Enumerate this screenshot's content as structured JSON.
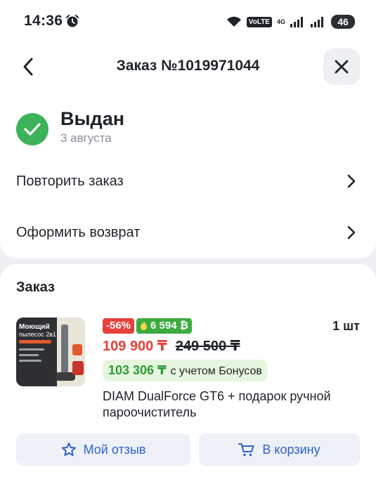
{
  "status_bar": {
    "time": "14:36",
    "volte": "VoLTE",
    "network": "4G",
    "battery": "46",
    "icons": [
      "alarm-icon",
      "wifi-icon",
      "signal-icon",
      "signal-icon",
      "battery-icon"
    ]
  },
  "header": {
    "title": "Заказ №1019971044",
    "back_icon": "chevron-left-icon",
    "close_icon": "close-icon"
  },
  "order_status": {
    "title": "Выдан",
    "date": "3 августа",
    "icon": "check-circle-icon",
    "color": "#3cb35a"
  },
  "actions": [
    {
      "label": "Повторить заказ"
    },
    {
      "label": "Оформить возврат"
    }
  ],
  "order": {
    "section_title": "Заказ",
    "item": {
      "thumbnail_text_1": "Моющий",
      "thumbnail_text_2": "пылесос 2в1",
      "discount": "-56%",
      "bonus": "6 594 ₿",
      "quantity": "1 шт",
      "price": "109 900 ₸",
      "old_price": "249 500 ₸",
      "bonus_price_value": "103 306 ₸",
      "bonus_price_note": "с учетом Бонусов",
      "name": "DIAM DualForce GT6 + подарок ручной пароочиститель"
    },
    "buttons": {
      "review": "Мой отзыв",
      "cart": "В корзину"
    }
  },
  "colors": {
    "accent": "#2f64c9",
    "discount": "#e7413b",
    "bonus": "#3cab3f"
  }
}
